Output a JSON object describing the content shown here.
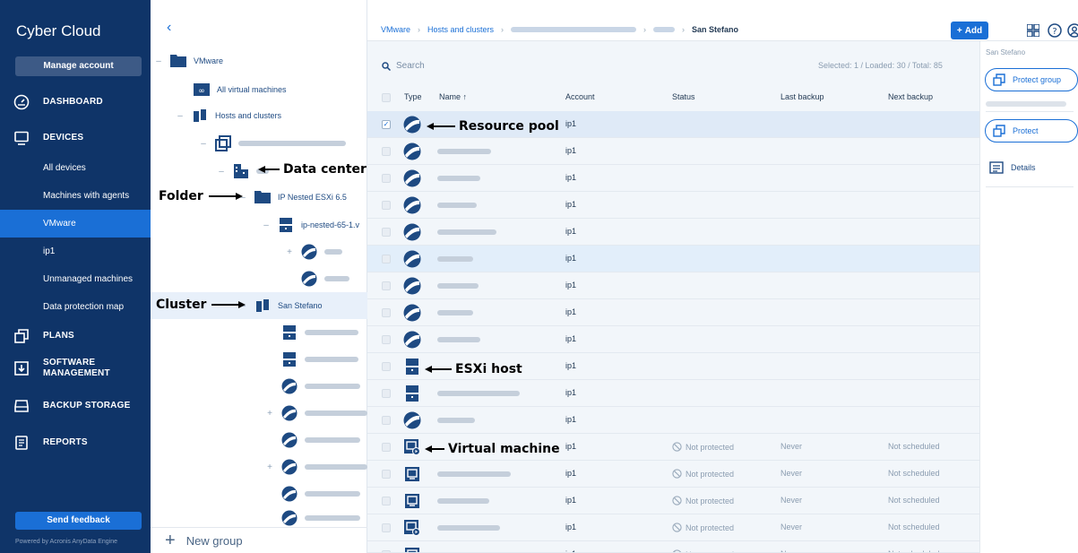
{
  "nav": {
    "brand": "Cyber Cloud",
    "manage_account": "Manage account",
    "sections": {
      "dashboard": "DASHBOARD",
      "devices": "DEVICES",
      "plans": "PLANS",
      "software_line1": "SOFTWARE",
      "software_line2": "MANAGEMENT",
      "backup_storage": "BACKUP STORAGE",
      "reports": "REPORTS"
    },
    "device_items": [
      "All devices",
      "Machines with agents",
      "VMware",
      "ip1",
      "Unmanaged machines",
      "Data protection map"
    ],
    "send_feedback": "Send feedback",
    "powered_by": "Powered by Acronis AnyData Engine"
  },
  "tree": {
    "vmware": "VMware",
    "all_vms": "All virtual machines",
    "hosts_clusters": "Hosts and clusters",
    "nested_folder": "IP Nested ESXi 6.5",
    "nested_host": "ip-nested-65-1.v",
    "cluster": "San Stefano",
    "new_group": "New group"
  },
  "breadcrumb": {
    "items": [
      "VMware",
      "Hosts and clusters"
    ],
    "current": "San Stefano"
  },
  "toolbar": {
    "add": "Add"
  },
  "search": {
    "label": "Search",
    "counts": "Selected: 1 / Loaded: 30 / Total: 85"
  },
  "table": {
    "headers": {
      "type": "Type",
      "name": "Name ↑",
      "account": "Account",
      "status": "Status",
      "last_backup": "Last backup",
      "next_backup": "Next backup"
    },
    "account": "ip1",
    "status_not_protected": "Not protected",
    "last_never": "Never",
    "next_not_scheduled": "Not scheduled"
  },
  "right_panel": {
    "title": "San Stefano",
    "protect_group": "Protect group",
    "protect": "Protect",
    "details": "Details"
  },
  "annotations": {
    "resource_pool": "Resource pool",
    "data_center": "Data center",
    "folder": "Folder",
    "cluster": "Cluster",
    "esxi_host": "ESXi host",
    "virtual_machine": "Virtual machine"
  },
  "colors": {
    "nav_bg": "#0f3468",
    "accent": "#1a6fd6",
    "icon": "#1e4a82"
  }
}
